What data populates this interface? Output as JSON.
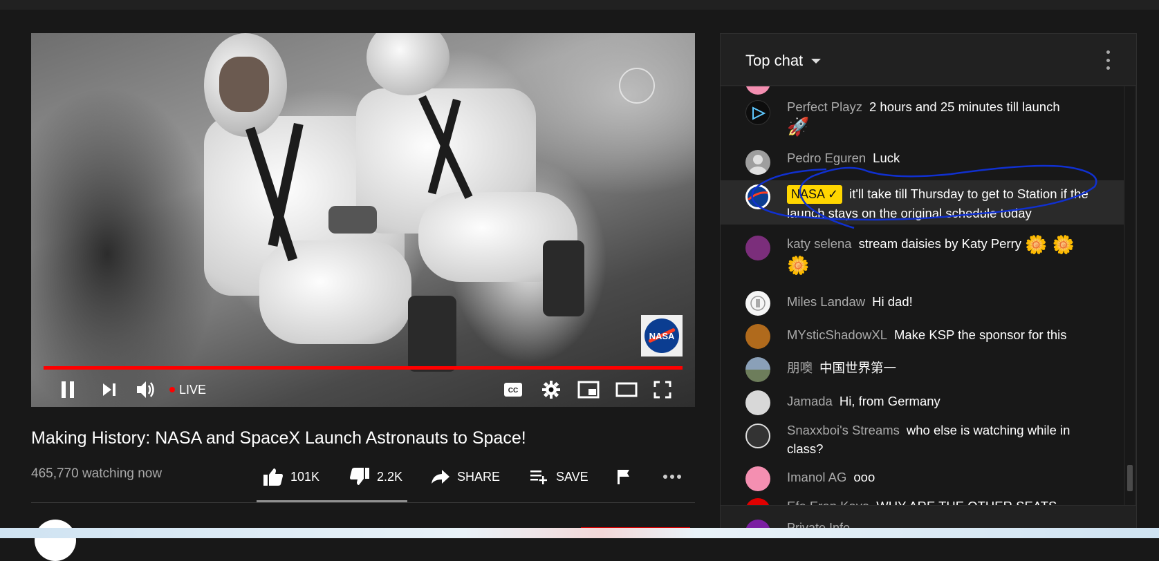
{
  "video": {
    "live_label": "LIVE",
    "watermark": "NASA"
  },
  "info": {
    "title": "Making History: NASA and SpaceX Launch Astronauts to Space!",
    "viewers": "465,770 watching now",
    "likes": "101K",
    "dislikes": "2.2K",
    "share_label": "SHARE",
    "save_label": "SAVE"
  },
  "chat": {
    "header_label": "Top chat",
    "messages": [
      {
        "author": "Perfect Playz",
        "text": "2 hours and 25 minutes till launch",
        "emoji": "🚀",
        "avatar_color": "#0d0d0d"
      },
      {
        "author": "Pedro Eguren",
        "text": "Luck",
        "avatar_color": "#9e9e9e"
      },
      {
        "author": "NASA",
        "badge": "NASA ✓",
        "text": "it'll take till Thursday to get to Station if the launch stays on the original schedule today",
        "avatar_color": "#0b3d91"
      },
      {
        "author": "katy selena",
        "text": "stream daisies by Katy Perry",
        "emoji": "🌼 🌼",
        "emoji2": "🌼",
        "avatar_color": "#7b2e7b"
      },
      {
        "author": "Miles Landaw",
        "text": "Hi dad!",
        "avatar_color": "#f5f5f5"
      },
      {
        "author": "MYsticShadowXL",
        "text": "Make KSP the sponsor for this",
        "avatar_color": "#b06a1c"
      },
      {
        "author": "朋噢",
        "text": "中国世界第一",
        "avatar_color": "#6d7d5b"
      },
      {
        "author": "Jamada",
        "text": "Hi, from Germany",
        "avatar_color": "#d8d8d8"
      },
      {
        "author": "Snaxxboi's Streams",
        "text": "who else is watching while in class?",
        "avatar_color": "#333333"
      },
      {
        "author": "Imanol AG",
        "text": "ooo",
        "avatar_color": "#f48fb1"
      },
      {
        "author": "Efe Eren Kaya",
        "text": "WHY ARE THE OTHER SEATS",
        "avatar_color": "#e00000"
      }
    ],
    "footer_name": "Private Info"
  },
  "colors": {
    "accent_red": "#ff0000",
    "badge_yellow": "#ffd600",
    "scroll_blue": "#3ea6ff",
    "annotation_blue": "#1030d0"
  }
}
